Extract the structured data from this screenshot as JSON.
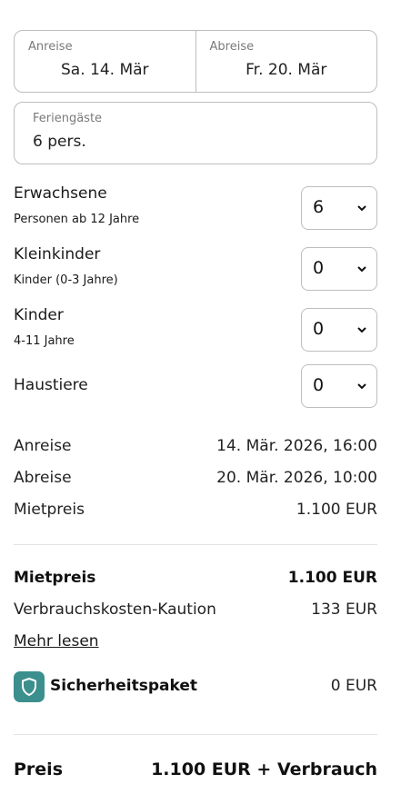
{
  "dates": {
    "arrival_label": "Anreise",
    "arrival_value": "Sa. 14. Mär",
    "departure_label": "Abreise",
    "departure_value": "Fr. 20. Mär"
  },
  "guests": {
    "label": "Feriengäste",
    "value": "6 pers."
  },
  "categories": [
    {
      "title": "Erwachsene",
      "subtitle": "Personen ab 12 Jahre",
      "value": "6"
    },
    {
      "title": "Kleinkinder",
      "subtitle": "Kinder (0-3 Jahre)",
      "value": "0"
    },
    {
      "title": "Kinder",
      "subtitle": "4-11 Jahre",
      "value": "0"
    },
    {
      "title": "Haustiere",
      "subtitle": "",
      "value": "0"
    }
  ],
  "details": [
    {
      "label": "Anreise",
      "value": "14. Mär. 2026, 16:00"
    },
    {
      "label": "Abreise",
      "value": "20. Mär. 2026, 10:00"
    },
    {
      "label": "Mietpreis",
      "value": "1.100 EUR"
    }
  ],
  "summary": {
    "rent_label": "Mietpreis",
    "rent_value": "1.100 EUR",
    "deposit_label": "Verbrauchskosten-Kaution",
    "deposit_value": "133 EUR",
    "read_more": "Mehr lesen",
    "safety_label": "Sicherheitspaket",
    "safety_value": "0 EUR",
    "safety_icon": "shield-icon",
    "safety_icon_color": "#3b8f8d"
  },
  "total": {
    "label": "Preis",
    "value": "1.100 EUR + Verbrauch"
  }
}
